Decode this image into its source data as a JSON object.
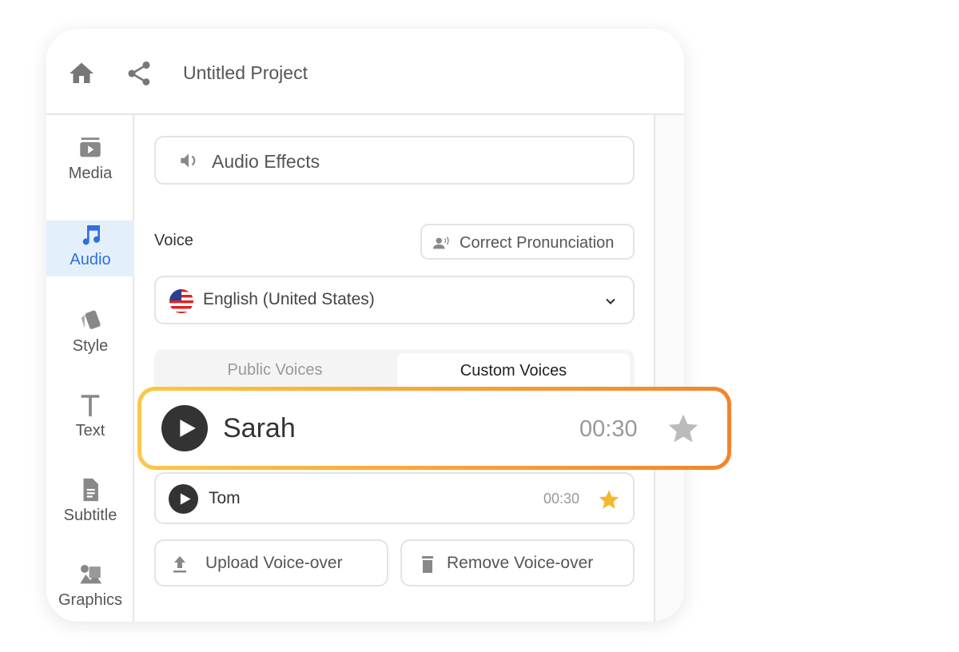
{
  "header": {
    "title": "Untitled Project",
    "icons": [
      "home-icon",
      "share-icon"
    ]
  },
  "sidebar": {
    "items": [
      {
        "label": "Media",
        "icon": "media-icon"
      },
      {
        "label": "Audio",
        "icon": "music-note-icon",
        "active": true
      },
      {
        "label": "Style",
        "icon": "style-icon"
      },
      {
        "label": "Text",
        "icon": "text-icon"
      },
      {
        "label": "Subtitle",
        "icon": "document-icon"
      },
      {
        "label": "Graphics",
        "icon": "graphics-icon"
      }
    ]
  },
  "panel": {
    "audio_effects": "Audio Effects",
    "voice_label": "Voice",
    "correct_pronunciation": "Correct Pronunciation",
    "language": "English (United States)",
    "tabs": [
      "Public Voices",
      "Custom Voices"
    ],
    "active_tab": "Custom Voices",
    "voices": [
      {
        "name": "Sarah",
        "duration": "00:30",
        "favorite": false,
        "highlighted": true
      },
      {
        "name": "Tom",
        "duration": "00:30",
        "favorite": true
      }
    ],
    "upload": "Upload Voice-over",
    "remove": "Remove Voice-over"
  },
  "colors": {
    "accent": "#2f6fe0",
    "star": "#f2b92c",
    "highlight_start": "#fcc846",
    "highlight_end": "#f3842d"
  }
}
